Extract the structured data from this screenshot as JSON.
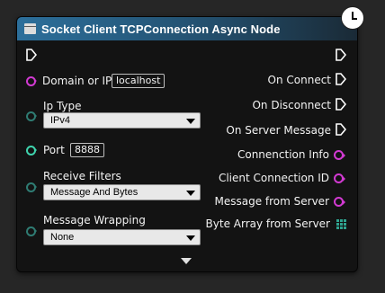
{
  "node": {
    "title": "Socket Client TCPConnection Async Node",
    "inputs": {
      "domain_label": "Domain or IP",
      "domain_value": "localhost",
      "ip_type_label": "Ip Type",
      "ip_type_value": "IPv4",
      "port_label": "Port",
      "port_value": "8888",
      "receive_filters_label": "Receive Filters",
      "receive_filters_value": "Message And Bytes",
      "message_wrapping_label": "Message Wrapping",
      "message_wrapping_value": "None"
    },
    "outputs": {
      "on_connect": "On Connect",
      "on_disconnect": "On Disconnect",
      "on_server_message": "On Server Message",
      "connection_info": "Connenction Info",
      "client_connection_id": "Client Connection ID",
      "message_from_server": "Message from Server",
      "byte_array_from_server": "Byte Array from Server"
    }
  },
  "colors": {
    "header_start": "#2c6f9b",
    "string_pin": "#d23ad2",
    "byte_pin": "#2f7c73",
    "int_pin": "#3fd4ae",
    "exec_pin": "#ffffff"
  },
  "icons": {
    "node_icon": "node-function-icon",
    "async_icon": "clock-icon",
    "expand_icon": "chevron-down-icon"
  }
}
